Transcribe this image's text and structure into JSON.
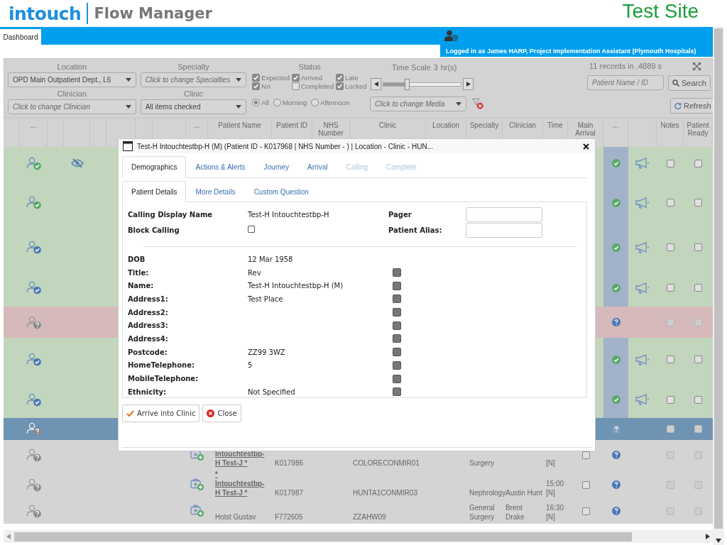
{
  "header": {
    "brand": "intouch",
    "product": "Flow Manager",
    "site": "Test Site"
  },
  "nav": {
    "tabs": [
      {
        "label": "Dashboard",
        "selected": true
      }
    ],
    "user": "Logged in as James HARP, Project Implementation Assistant (Plymouth Hospitals)"
  },
  "filters": {
    "location": {
      "label": "Location",
      "value": "OPD Main Outpatient Dept., L6"
    },
    "specialty": {
      "label": "Specialty",
      "placeholder": "Click to change Specialties"
    },
    "status": {
      "label": "Status",
      "options": [
        {
          "label": "Expected",
          "checked": true
        },
        {
          "label": "Arrived",
          "checked": true
        },
        {
          "label": "Late",
          "checked": true
        },
        {
          "label": "NA",
          "checked": true
        },
        {
          "label": "Completed",
          "checked": false
        },
        {
          "label": "Locked",
          "checked": true
        }
      ]
    },
    "time_scale": {
      "label": "Time Scale",
      "value": "3",
      "unit": "hr(s)",
      "level": 0.3
    },
    "records": "11 records in .4889 s",
    "clinician": {
      "label": "Clinician",
      "placeholder": "Click to change Clinician"
    },
    "clinic": {
      "label": "Clinic",
      "value": "All items checked"
    },
    "session": [
      {
        "label": "All",
        "selected": true
      },
      {
        "label": "Morning",
        "selected": false
      },
      {
        "label": "Afternoon",
        "selected": false
      }
    ],
    "media": {
      "placeholder": "Click to change Media"
    },
    "search": {
      "placeholder": "Patient Name / ID",
      "button": "Search"
    },
    "refresh": "Refresh"
  },
  "table": {
    "columns": [
      {},
      {
        "label": "..."
      },
      {},
      {},
      {},
      {},
      {},
      {},
      {
        "label": "..."
      },
      {
        "label": "Patient Name"
      },
      {
        "label": "Patient ID"
      },
      {
        "label": "NHS Number"
      },
      {
        "label": "Clinic"
      },
      {
        "label": "Location"
      },
      {
        "label": "Specialty"
      },
      {
        "label": "Clinician"
      },
      {
        "label": "Time"
      },
      {
        "label": "Main Arrival"
      },
      {
        "label": "..."
      },
      {},
      {
        "label": "Notes"
      },
      {
        "label": "Patient Ready"
      }
    ],
    "rows": [
      {
        "color": "#c1d6bc",
        "selected": false,
        "icon": {
          "kind": "called"
        },
        "arrived": true,
        "callable": true,
        "hidden": true,
        "notes": {
          "checked": false,
          "disabled": false
        },
        "ready": {
          "checked": false,
          "disabled": false
        }
      },
      {
        "color": "#c1d6bc",
        "selected": false,
        "icon": {
          "kind": "called"
        },
        "arrived": true,
        "callable": true,
        "hidden": false,
        "notes": {
          "checked": false,
          "disabled": false
        },
        "ready": {
          "checked": false,
          "disabled": false
        }
      },
      {
        "color": "#c1d6bc",
        "selected": false,
        "icon": {
          "kind": "arrived"
        },
        "arrived": true,
        "callable": true,
        "hidden": false,
        "notes": {
          "checked": false,
          "disabled": false
        },
        "ready": {
          "checked": false,
          "disabled": false
        }
      },
      {
        "color": "#c1d6bc",
        "selected": false,
        "icon": {
          "kind": "arrived"
        },
        "arrived": true,
        "callable": true,
        "hidden": false,
        "notes": {
          "checked": false,
          "disabled": false
        },
        "ready": {
          "checked": false,
          "disabled": false
        }
      },
      {
        "color": "#d6b9ba",
        "selected": false,
        "icon": {
          "kind": "pending"
        },
        "arrived": false,
        "callable": false,
        "hidden": false,
        "notes": {
          "checked": false,
          "disabled": true
        },
        "ready": {
          "checked": false,
          "disabled": true
        }
      },
      {
        "color": "#c1d6bc",
        "selected": false,
        "icon": {
          "kind": "arrived"
        },
        "arrived": true,
        "callable": true,
        "hidden": false,
        "notes": {
          "checked": false,
          "disabled": false
        },
        "ready": {
          "checked": false,
          "disabled": false
        }
      },
      {
        "color": "#c1d6bc",
        "selected": false,
        "icon": {
          "kind": "arrived"
        },
        "arrived": true,
        "callable": true,
        "hidden": false,
        "notes": {
          "checked": false,
          "disabled": false
        },
        "ready": {
          "checked": false,
          "disabled": false
        }
      },
      {
        "color": "#6f93b2",
        "selected": true,
        "icon": {
          "kind": "pending"
        },
        "arrived": false,
        "callable": false,
        "hidden": false,
        "notes": {
          "checked": false,
          "disabled": true
        },
        "ready": {
          "checked": false,
          "disabled": true
        }
      },
      {
        "color": "#d4d4d4",
        "selected": false,
        "icon": {
          "kind": "pending"
        },
        "arrived": false,
        "callable": false,
        "hidden": false,
        "notes": {
          "checked": false,
          "disabled": true
        },
        "ready": {
          "checked": false,
          "disabled": true
        },
        "patient": {
          "name": "Intouchtestbp-H Test-J *",
          "link": true
        },
        "patient_id": "K017986",
        "clinic": "COLORECONMIR01",
        "specialty": "Surgery",
        "time": "[N]",
        "main_arrival": false
      },
      {
        "color": "#d4d4d4",
        "selected": false,
        "icon": {
          "kind": "pending"
        },
        "arrived": false,
        "callable": false,
        "hidden": false,
        "notes": {
          "checked": false,
          "disabled": true
        },
        "ready": {
          "checked": false,
          "disabled": true
        },
        "patient": {
          "name": "* Intouchtestbp-H Test-J *",
          "link": true
        },
        "patient_id": "K017987",
        "clinic": "HUNTA1CONMIR03",
        "specialty": "Nephrology",
        "clinician": "Austin Hunt",
        "time": "15:00 [N]",
        "main_arrival": false
      },
      {
        "color": "#d4d4d4",
        "selected": false,
        "icon": {
          "kind": "pending"
        },
        "arrived": false,
        "callable": false,
        "hidden": false,
        "notes": {
          "checked": false,
          "disabled": true
        },
        "ready": {
          "checked": false,
          "disabled": true
        },
        "patient": {
          "name": "Holst Gustav",
          "link": false
        },
        "patient_id": "F772605",
        "clinic": "ZZAHW09",
        "specialty": "General Surgery",
        "clinician": "Brent Drake",
        "time": "16:30 [N]",
        "main_arrival": false
      }
    ]
  },
  "modal": {
    "title": "Test-H Intouchtestbp-H (M) (Patient ID - K017968 | NHS Number - ) | Location - Clinic - HUN...",
    "tabs": [
      {
        "label": "Demographics",
        "selected": true,
        "disabled": false
      },
      {
        "label": "Actions & Alerts",
        "selected": false,
        "disabled": false
      },
      {
        "label": "Journey",
        "selected": false,
        "disabled": false
      },
      {
        "label": "Arrival",
        "selected": false,
        "disabled": false
      },
      {
        "label": "Calling",
        "selected": false,
        "disabled": true
      },
      {
        "label": "Complete",
        "selected": false,
        "disabled": true
      }
    ],
    "subtabs": [
      {
        "label": "Patient Details",
        "selected": true
      },
      {
        "label": "More Details",
        "selected": false
      },
      {
        "label": "Custom Question",
        "selected": false
      }
    ],
    "calling_name": {
      "label": "Calling Display Name",
      "value": "Test-H Intouchtestbp-H"
    },
    "block_calling": {
      "label": "Block Calling",
      "checked": false
    },
    "side_fields": [
      {
        "label": "Pager"
      },
      {
        "label": "Patient Alias:"
      }
    ],
    "details": [
      {
        "label": "DOB",
        "value": "12 Mar 1958"
      },
      {
        "label": "Title:",
        "value": "Rev",
        "checked": false
      },
      {
        "label": "Name:",
        "value": "Test-H Intouchtestbp-H (M)",
        "checked": false
      },
      {
        "label": "Address1:",
        "value": "Test Place",
        "checked": false
      },
      {
        "label": "Address2:",
        "checked": false
      },
      {
        "label": "Address3:",
        "checked": false
      },
      {
        "label": "Address4:",
        "checked": false
      },
      {
        "label": "Postcode:",
        "value": "ZZ99 3WZ",
        "checked": false
      },
      {
        "label": "HomeTelephone:",
        "value": "5",
        "checked": false
      },
      {
        "label": "MobileTelephone:",
        "checked": false
      },
      {
        "label": "Ethnicity:",
        "value": "Not Specified",
        "checked": false
      }
    ],
    "actions": [
      {
        "label": "Arrive into Clinic",
        "kind": "arrive"
      },
      {
        "label": "Close",
        "kind": "close"
      }
    ]
  }
}
